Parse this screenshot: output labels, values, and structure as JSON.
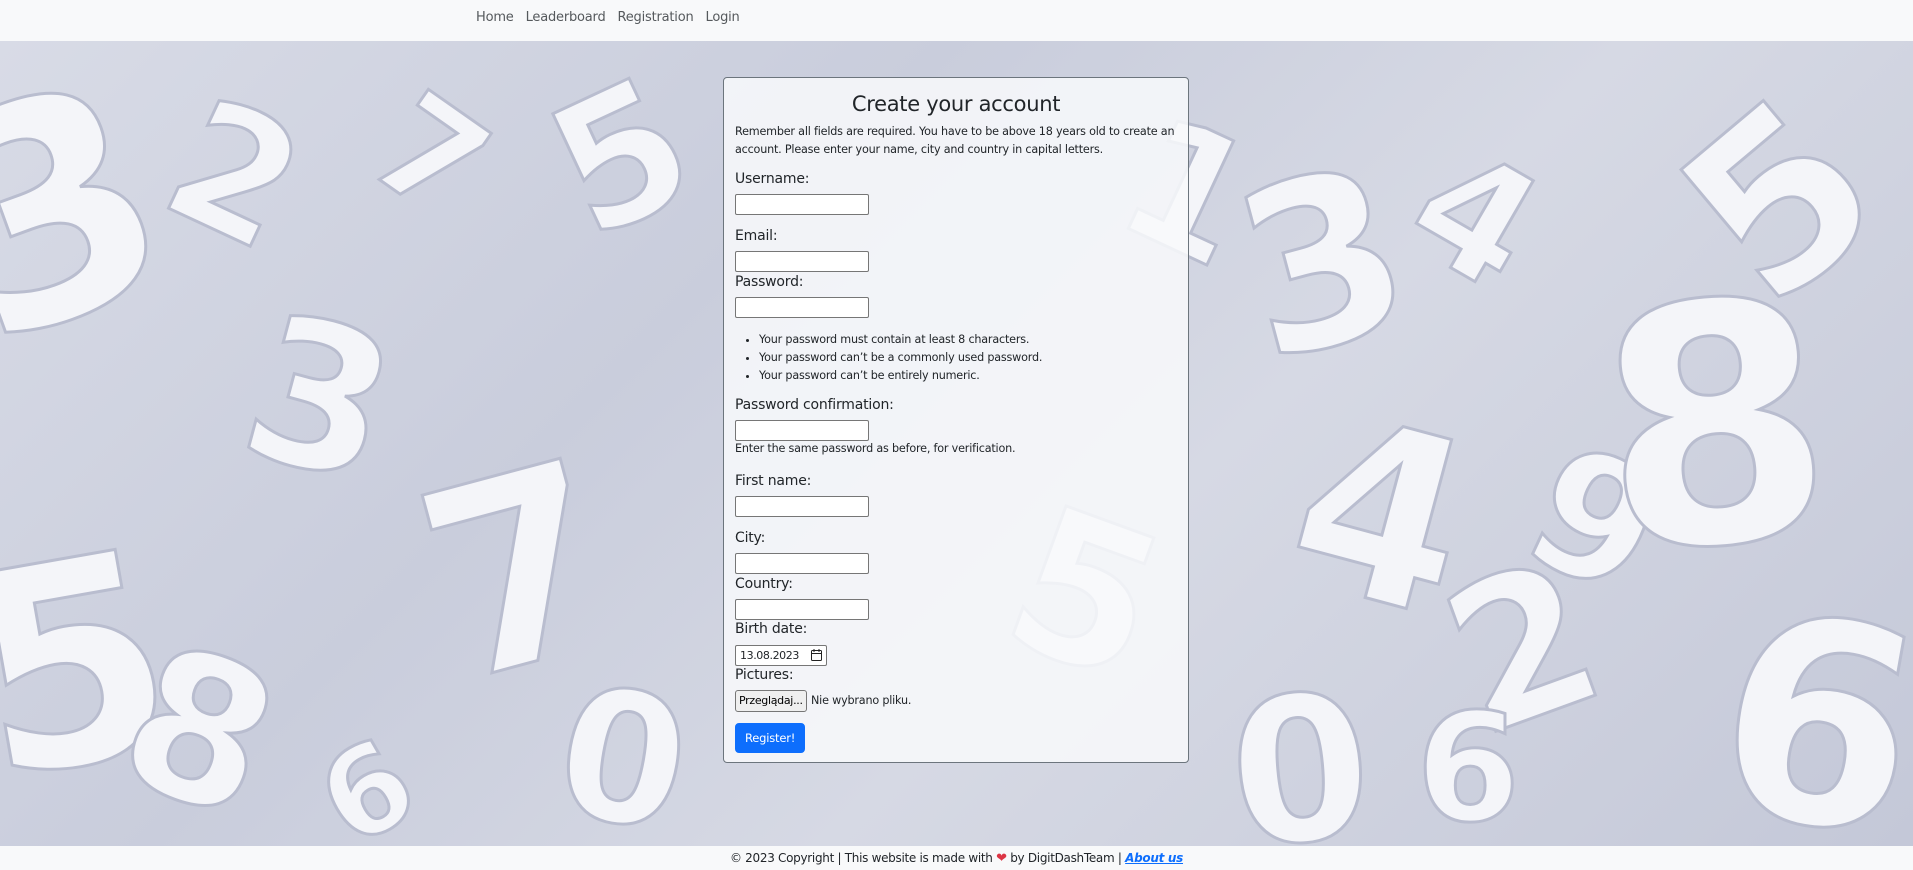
{
  "nav": {
    "items": [
      "Home",
      "Leaderboard",
      "Registration",
      "Login"
    ]
  },
  "form": {
    "title": "Create your account",
    "intro": "Remember all fields are required. You have to be above 18 years old to create an account. Please enter your name, city and country in capital letters.",
    "username_label": "Username:",
    "email_label": "Email:",
    "password_label": "Password:",
    "password_help": [
      "Your password must contain at least 8 characters.",
      "Your password can’t be a commonly used password.",
      "Your password can’t be entirely numeric."
    ],
    "password_confirm_label": "Password confirmation:",
    "password_confirm_help": "Enter the same password as before, for verification.",
    "first_name_label": "First name:",
    "city_label": "City:",
    "country_label": "Country:",
    "birth_date_label": "Birth date:",
    "birth_date_value": "13.08.2023",
    "pictures_label": "Pictures:",
    "file_button_label": "Przeglądaj...",
    "file_status": "Nie wybrano pliku.",
    "submit_label": "Register!"
  },
  "footer": {
    "prefix": "© 2023 Copyright | This website is made with",
    "suffix": "by DigitDashTeam |",
    "about_link": "About us"
  },
  "colors": {
    "primary": "#0d6efd",
    "heart": "#dc3545",
    "navbar_bg": "#f8f9fa"
  },
  "icons": {
    "calendar": "calendar-icon",
    "heart": "heart-icon"
  }
}
